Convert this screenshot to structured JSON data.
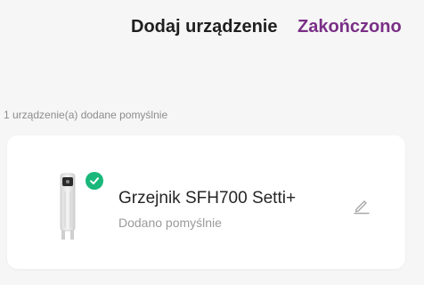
{
  "header": {
    "title": "Dodaj urządzenie",
    "done_label": "Zakończono"
  },
  "summary_text": "1 urządzenie(a) dodane pomyślnie",
  "device": {
    "name": "Grzejnik SFH700 Setti+",
    "status": "Dodano pomyślnie",
    "icon": "heater-icon",
    "badge_icon": "check-circle-icon",
    "edit_icon": "pencil-icon"
  },
  "colors": {
    "accent": "#7a2f86",
    "success": "#19b77a",
    "background": "#f6f6f6",
    "card": "#ffffff"
  }
}
